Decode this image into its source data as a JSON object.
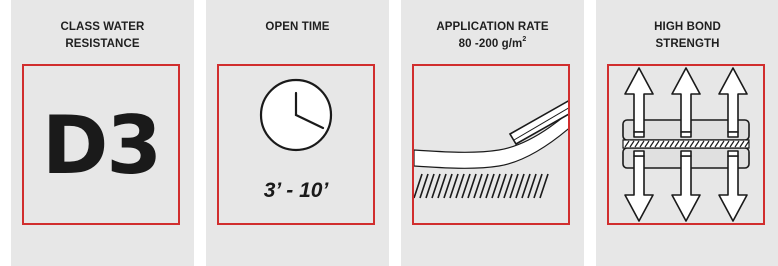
{
  "cards": [
    {
      "title_line1": "CLASS WATER",
      "title_line2": "RESISTANCE",
      "content": "D3"
    },
    {
      "title_line1": "OPEN TIME",
      "title_line2": "",
      "content": "3’ - 10’",
      "icon": "clock-icon"
    },
    {
      "title_line1": "APPLICATION RATE",
      "title_line2": "80 -200 g/m",
      "title_sup": "2",
      "icon": "spreading-trowel-icon"
    },
    {
      "title_line1": "HIGH BOND",
      "title_line2": "STRENGTH",
      "icon": "bond-strength-arrows-icon"
    }
  ],
  "colors": {
    "card_bg": "#e7e7e7",
    "frame": "#d12e2e",
    "text": "#1a1a1a"
  }
}
